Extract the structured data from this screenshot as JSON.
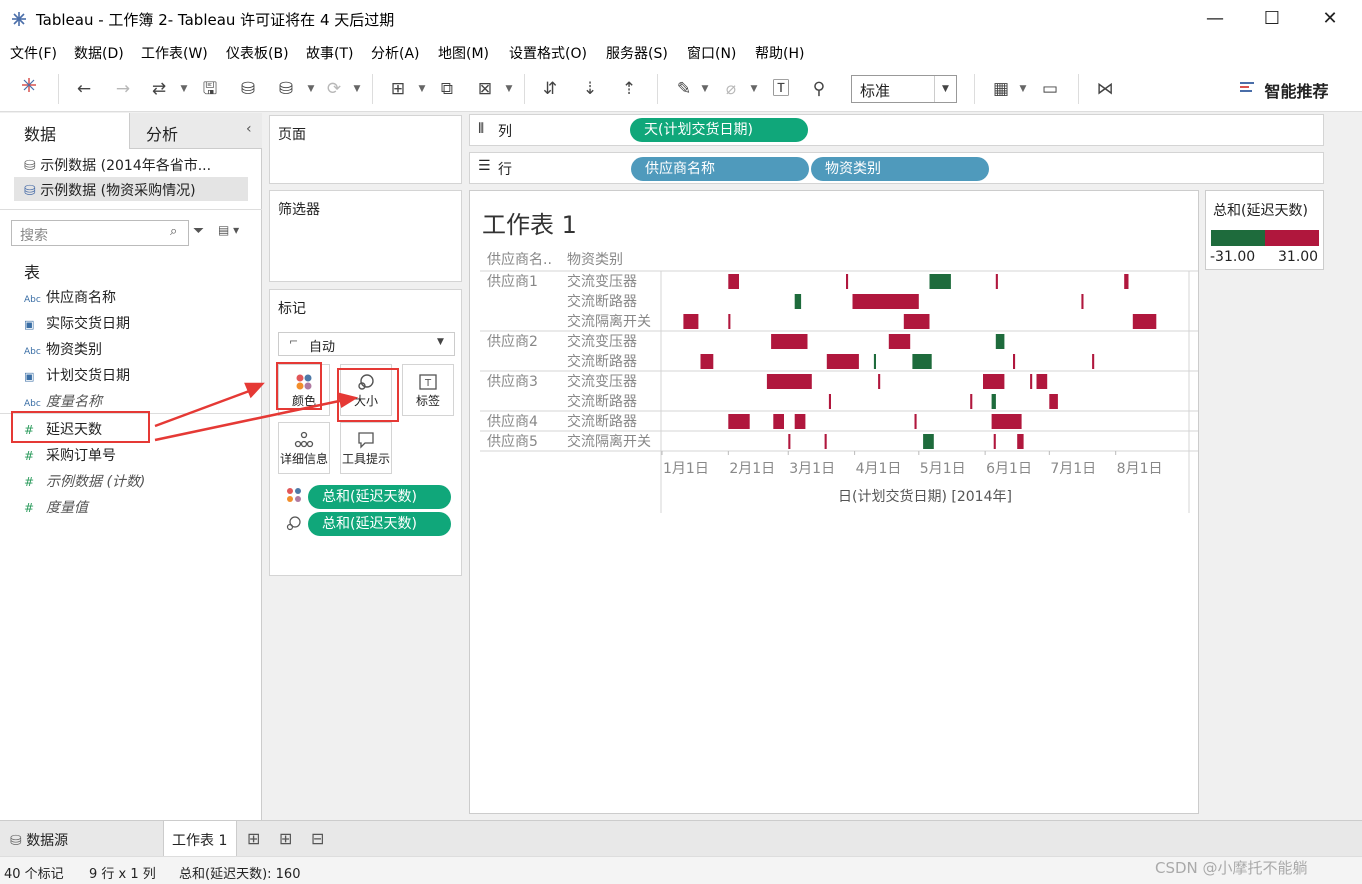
{
  "window": {
    "title": "Tableau - 工作簿 2- Tableau 许可证将在 4 天后过期",
    "minimize": "—",
    "maximize": "☐",
    "close": "✕"
  },
  "menu": [
    "文件(F)",
    "数据(D)",
    "工作表(W)",
    "仪表板(B)",
    "故事(T)",
    "分析(A)",
    "地图(M)",
    "设置格式(O)",
    "服务器(S)",
    "窗口(N)",
    "帮助(H)"
  ],
  "toolbar": {
    "fit_select": "标准",
    "smart_label": "智能推荐"
  },
  "data_pane": {
    "tab_data": "数据",
    "tab_analysis": "分析",
    "sources": [
      "示例数据 (2014年各省市...",
      "示例数据 (物资采购情况)"
    ],
    "search_placeholder": "搜索",
    "table_heading": "表",
    "dimensions": [
      {
        "icon": "Abc",
        "name": "供应商名称"
      },
      {
        "icon": "📅",
        "name": "实际交货日期"
      },
      {
        "icon": "Abc",
        "name": "物资类别"
      },
      {
        "icon": "📅",
        "name": "计划交货日期"
      },
      {
        "icon": "Abc",
        "name": "度量名称"
      }
    ],
    "measures": [
      {
        "icon": "#",
        "name": "延迟天数"
      },
      {
        "icon": "#",
        "name": "采购订单号"
      },
      {
        "icon": "#",
        "name": "示例数据 (计数)"
      },
      {
        "icon": "#",
        "name": "度量值"
      }
    ]
  },
  "shelves": {
    "pages": "页面",
    "filters": "筛选器",
    "columns_label": "列",
    "rows_label": "行",
    "columns": [
      "天(计划交货日期)"
    ],
    "rows": [
      "供应商名称",
      "物资类别"
    ]
  },
  "marks": {
    "title": "标记",
    "type": "自动",
    "buttons": [
      "颜色",
      "大小",
      "标签",
      "详细信息",
      "工具提示"
    ],
    "pills": [
      "总和(延迟天数)",
      "总和(延迟天数)"
    ]
  },
  "legend": {
    "title": "总和(延迟天数)",
    "min": "-31.00",
    "max": "31.00",
    "neg_color": "#1e6b3c",
    "pos_color": "#b0173d"
  },
  "sheet": {
    "title": "工作表 1",
    "header_supplier": "供应商名..",
    "header_category": "物资类别",
    "axis_title": "日(计划交货日期) [2014年]"
  },
  "chart_data": {
    "type": "gantt",
    "x_ticks": [
      "1月1日",
      "2月1日",
      "3月1日",
      "4月1日",
      "5月1日",
      "6月1日",
      "7月1日",
      "8月1日"
    ],
    "xlabel": "日(计划交货日期) [2014年]",
    "rows": [
      {
        "supplier": "供应商1",
        "category": "交流变压器",
        "bars": [
          {
            "start": "2014-02-01",
            "days": 5,
            "color": "pos"
          },
          {
            "start": "2014-03-28",
            "days": 1,
            "color": "pos"
          },
          {
            "start": "2014-05-06",
            "days": 10,
            "color": "neg"
          },
          {
            "start": "2014-06-06",
            "days": 1,
            "color": "pos"
          },
          {
            "start": "2014-08-05",
            "days": 2,
            "color": "pos"
          }
        ]
      },
      {
        "supplier": "",
        "category": "交流断路器",
        "bars": [
          {
            "start": "2014-03-04",
            "days": 3,
            "color": "neg"
          },
          {
            "start": "2014-03-31",
            "days": 31,
            "color": "pos"
          },
          {
            "start": "2014-07-16",
            "days": 1,
            "color": "pos"
          }
        ]
      },
      {
        "supplier": "",
        "category": "交流隔离开关",
        "bars": [
          {
            "start": "2014-01-11",
            "days": 7,
            "color": "pos"
          },
          {
            "start": "2014-02-01",
            "days": 1,
            "color": "pos"
          },
          {
            "start": "2014-04-24",
            "days": 12,
            "color": "pos"
          },
          {
            "start": "2014-08-09",
            "days": 11,
            "color": "pos"
          }
        ]
      },
      {
        "supplier": "供应商2",
        "category": "交流变压器",
        "bars": [
          {
            "start": "2014-02-21",
            "days": 17,
            "color": "pos"
          },
          {
            "start": "2014-04-17",
            "days": 10,
            "color": "pos"
          },
          {
            "start": "2014-06-06",
            "days": 4,
            "color": "neg"
          }
        ]
      },
      {
        "supplier": "",
        "category": "交流断路器",
        "bars": [
          {
            "start": "2014-01-19",
            "days": 6,
            "color": "pos"
          },
          {
            "start": "2014-03-19",
            "days": 15,
            "color": "pos"
          },
          {
            "start": "2014-04-10",
            "days": 1,
            "color": "neg"
          },
          {
            "start": "2014-04-28",
            "days": 9,
            "color": "neg"
          },
          {
            "start": "2014-06-14",
            "days": 1,
            "color": "pos"
          },
          {
            "start": "2014-07-21",
            "days": 1,
            "color": "pos"
          }
        ]
      },
      {
        "supplier": "供应商3",
        "category": "交流变压器",
        "bars": [
          {
            "start": "2014-02-19",
            "days": 21,
            "color": "pos"
          },
          {
            "start": "2014-04-12",
            "days": 1,
            "color": "pos"
          },
          {
            "start": "2014-05-31",
            "days": 10,
            "color": "pos"
          },
          {
            "start": "2014-06-22",
            "days": 1,
            "color": "pos"
          },
          {
            "start": "2014-06-25",
            "days": 5,
            "color": "pos"
          }
        ]
      },
      {
        "supplier": "",
        "category": "交流断路器",
        "bars": [
          {
            "start": "2014-03-20",
            "days": 1,
            "color": "pos"
          },
          {
            "start": "2014-05-25",
            "days": 1,
            "color": "pos"
          },
          {
            "start": "2014-06-04",
            "days": 2,
            "color": "neg"
          },
          {
            "start": "2014-07-01",
            "days": 4,
            "color": "pos"
          }
        ]
      },
      {
        "supplier": "供应商4",
        "category": "交流断路器",
        "bars": [
          {
            "start": "2014-02-01",
            "days": 10,
            "color": "pos"
          },
          {
            "start": "2014-02-22",
            "days": 5,
            "color": "pos"
          },
          {
            "start": "2014-03-04",
            "days": 5,
            "color": "pos"
          },
          {
            "start": "2014-04-29",
            "days": 1,
            "color": "pos"
          },
          {
            "start": "2014-06-04",
            "days": 14,
            "color": "pos"
          }
        ]
      },
      {
        "supplier": "供应商5",
        "category": "交流隔离开关",
        "bars": [
          {
            "start": "2014-03-01",
            "days": 1,
            "color": "pos"
          },
          {
            "start": "2014-03-18",
            "days": 1,
            "color": "pos"
          },
          {
            "start": "2014-05-03",
            "days": 5,
            "color": "neg"
          },
          {
            "start": "2014-06-05",
            "days": 1,
            "color": "pos"
          },
          {
            "start": "2014-06-16",
            "days": 3,
            "color": "pos"
          }
        ]
      }
    ]
  },
  "bottom": {
    "datasource": "数据源",
    "sheet_tab": "工作表 1"
  },
  "status": {
    "marks": "40 个标记",
    "dims": "9 行 x 1 列",
    "sum": "总和(延迟天数): 160",
    "watermark": "CSDN @小摩托不能躺"
  }
}
